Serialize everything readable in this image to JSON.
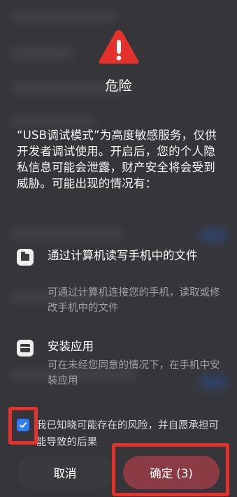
{
  "dialog": {
    "title": "危险",
    "body": "“USB调试模式”为高度敏感服务，仅供开发者调试使用。开启后，您的个人隐私信息可能会泄露，财产安全将会受到威胁。可能出现的情况有：",
    "risks": [
      {
        "icon": "folder-icon",
        "title": "通过计算机读写手机中的文件",
        "description": "可通过计算机连接您的手机，读取或修改手机中的文件"
      },
      {
        "icon": "package-icon",
        "title": "安装应用",
        "description": "可在未经您同意的情况下，在手机中安装应用"
      }
    ],
    "consent": {
      "checked": true,
      "text": "我已知晓可能存在的风险，并自愿承担可能导致的后果"
    },
    "buttons": {
      "cancel": "取消",
      "confirm": "确定 (3)"
    }
  },
  "colors": {
    "warning": "#e5312b",
    "checkbox": "#2f7df6",
    "highlight": "#e5312b"
  }
}
